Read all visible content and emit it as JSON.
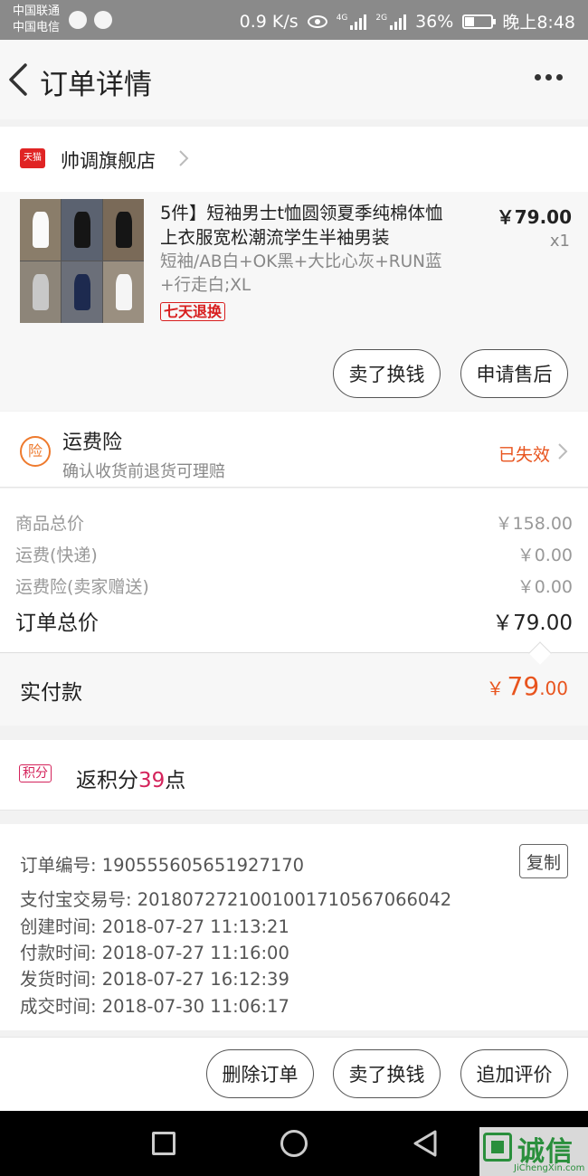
{
  "status_bar": {
    "carrier1": "中国联通",
    "carrier2": "中国电信",
    "speed": "0.9 K/s",
    "net1": "4G",
    "net2": "2G",
    "battery": "36%",
    "time": "晚上8:48"
  },
  "nav": {
    "title": "订单详情"
  },
  "store": {
    "badge": "天猫",
    "name": "帅调旗舰店"
  },
  "product": {
    "title": "5件】短袖男士t恤圆领夏季纯棉体恤上衣服宽松潮流学生半袖男装",
    "sku": "短袖/AB白+OK黑+大比心灰+RUN蓝+行走白;XL",
    "tag": "七天退换",
    "price": "￥79.00",
    "qty": "x1",
    "buttons": {
      "resell": "卖了换钱",
      "after_sale": "申请售后"
    }
  },
  "insurance": {
    "icon_text": "险",
    "title": "运费险",
    "subtitle": "确认收货前退货可理赔",
    "status": "已失效"
  },
  "summary": {
    "rows": [
      {
        "label": "商品总价",
        "value": "￥158.00"
      },
      {
        "label": "运费(快递)",
        "value": "￥0.00"
      },
      {
        "label": "运费险(卖家赠送)",
        "value": "￥0.00"
      }
    ],
    "total_label": "订单总价",
    "total_value": "￥79.00",
    "paid_label": "实付款",
    "paid_symbol": "￥",
    "paid_int": "79",
    "paid_dec": ".00"
  },
  "points": {
    "badge": "积分",
    "prefix": "返积分",
    "num": "39",
    "suffix": "点"
  },
  "order_info": {
    "copy_label": "复制",
    "lines": [
      "订单编号: 1905556056519271​70",
      "支付宝交易号: 2018072721001001710567066042",
      "创建时间: 2018-07-27 11:13:21",
      "付款时间: 2018-07-27 11:16:00",
      "发货时间: 2018-07-27 16:12:39",
      "成交时间: 2018-07-30 11:06:17"
    ]
  },
  "actions": {
    "delete": "删除订单",
    "resell": "卖了换钱",
    "review": "追加评价"
  },
  "watermark": {
    "text": "诚信",
    "sub": "JiChengXin.com"
  },
  "colors": {
    "accent_orange": "#e8541e",
    "points_pink": "#d4235b",
    "tmall_red": "#e02424"
  }
}
